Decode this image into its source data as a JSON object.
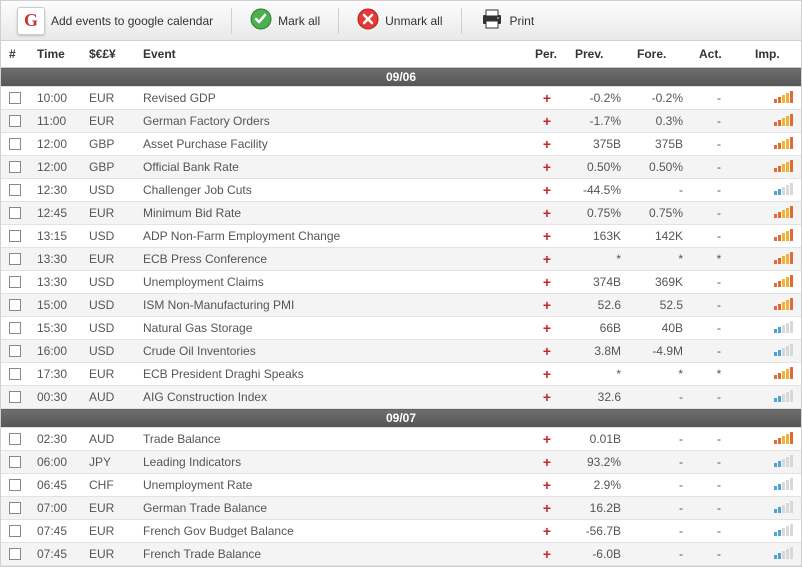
{
  "toolbar": {
    "google_label": "Add events to google calendar",
    "mark_label": "Mark all",
    "unmark_label": "Unmark all",
    "print_label": "Print"
  },
  "headers": {
    "num": "#",
    "time": "Time",
    "curr": "$€£¥",
    "event": "Event",
    "per": "Per.",
    "prev": "Prev.",
    "fore": "Fore.",
    "act": "Act.",
    "imp": "Imp."
  },
  "groups": [
    {
      "date": "09/06",
      "rows": [
        {
          "time": "10:00",
          "curr": "EUR",
          "event": "Revised GDP",
          "prev": "-0.2%",
          "fore": "-0.2%",
          "act": "-",
          "imp": "hi"
        },
        {
          "time": "11:00",
          "curr": "EUR",
          "event": "German Factory Orders",
          "prev": "-1.7%",
          "fore": "0.3%",
          "act": "-",
          "imp": "hi"
        },
        {
          "time": "12:00",
          "curr": "GBP",
          "event": "Asset Purchase Facility",
          "prev": "375B",
          "fore": "375B",
          "act": "-",
          "imp": "hi"
        },
        {
          "time": "12:00",
          "curr": "GBP",
          "event": "Official Bank Rate",
          "prev": "0.50%",
          "fore": "0.50%",
          "act": "-",
          "imp": "hi"
        },
        {
          "time": "12:30",
          "curr": "USD",
          "event": "Challenger Job Cuts",
          "prev": "-44.5%",
          "fore": "-",
          "act": "-",
          "imp": "lo"
        },
        {
          "time": "12:45",
          "curr": "EUR",
          "event": "Minimum Bid Rate",
          "prev": "0.75%",
          "fore": "0.75%",
          "act": "-",
          "imp": "hi"
        },
        {
          "time": "13:15",
          "curr": "USD",
          "event": "ADP Non-Farm Employment Change",
          "prev": "163K",
          "fore": "142K",
          "act": "-",
          "imp": "hi"
        },
        {
          "time": "13:30",
          "curr": "EUR",
          "event": "ECB Press Conference",
          "prev": "*",
          "fore": "*",
          "act": "*",
          "imp": "hi"
        },
        {
          "time": "13:30",
          "curr": "USD",
          "event": "Unemployment Claims",
          "prev": "374B",
          "fore": "369K",
          "act": "-",
          "imp": "hi"
        },
        {
          "time": "15:00",
          "curr": "USD",
          "event": "ISM Non-Manufacturing PMI",
          "prev": "52.6",
          "fore": "52.5",
          "act": "-",
          "imp": "hi"
        },
        {
          "time": "15:30",
          "curr": "USD",
          "event": "Natural Gas Storage",
          "prev": "66B",
          "fore": "40B",
          "act": "-",
          "imp": "lo"
        },
        {
          "time": "16:00",
          "curr": "USD",
          "event": "Crude Oil Inventories",
          "prev": "3.8M",
          "fore": "-4.9M",
          "act": "-",
          "imp": "lo"
        },
        {
          "time": "17:30",
          "curr": "EUR",
          "event": "ECB President Draghi Speaks",
          "prev": "*",
          "fore": "*",
          "act": "*",
          "imp": "hi"
        },
        {
          "time": "00:30",
          "curr": "AUD",
          "event": "AIG Construction Index",
          "prev": "32.6",
          "fore": "-",
          "act": "-",
          "imp": "lo"
        }
      ]
    },
    {
      "date": "09/07",
      "rows": [
        {
          "time": "02:30",
          "curr": "AUD",
          "event": "Trade Balance",
          "prev": "0.01B",
          "fore": "-",
          "act": "-",
          "imp": "hi"
        },
        {
          "time": "06:00",
          "curr": "JPY",
          "event": "Leading Indicators",
          "prev": "93.2%",
          "fore": "-",
          "act": "-",
          "imp": "lo"
        },
        {
          "time": "06:45",
          "curr": "CHF",
          "event": "Unemployment Rate",
          "prev": "2.9%",
          "fore": "-",
          "act": "-",
          "imp": "lo"
        },
        {
          "time": "07:00",
          "curr": "EUR",
          "event": "German Trade Balance",
          "prev": "16.2B",
          "fore": "-",
          "act": "-",
          "imp": "lo"
        },
        {
          "time": "07:45",
          "curr": "EUR",
          "event": "French Gov Budget Balance",
          "prev": "-56.7B",
          "fore": "-",
          "act": "-",
          "imp": "lo"
        },
        {
          "time": "07:45",
          "curr": "EUR",
          "event": "French Trade Balance",
          "prev": "-6.0B",
          "fore": "-",
          "act": "-",
          "imp": "lo"
        }
      ]
    }
  ]
}
